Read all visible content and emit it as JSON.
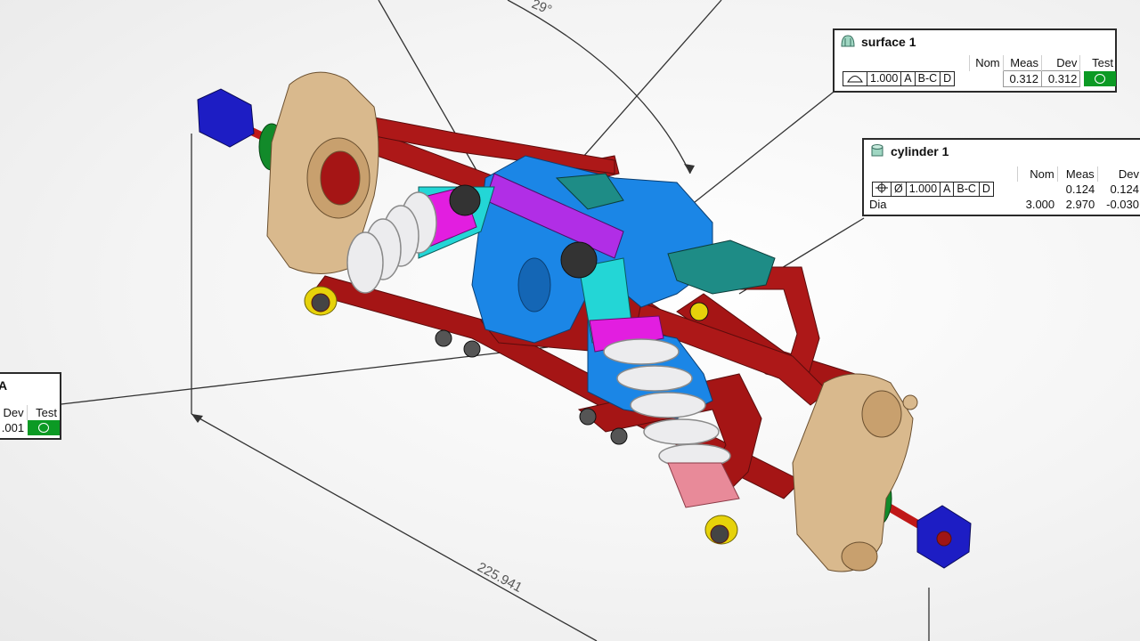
{
  "dimensions": {
    "linear_value": "225.941",
    "angle_value": "29°"
  },
  "callouts": {
    "surface": {
      "title": "surface 1",
      "headers": [
        "Nom",
        "Meas",
        "Dev",
        "Test"
      ],
      "fcf": [
        "1.000",
        "A",
        "B-C",
        "D"
      ],
      "meas": "0.312",
      "dev": "0.312",
      "test_status": "pass",
      "icon": "surface-feature-icon",
      "pass_color": "#0c9a24"
    },
    "cylinder": {
      "title": "cylinder 1",
      "headers": [
        "Nom",
        "Meas",
        "Dev"
      ],
      "fcf": [
        "Ø",
        "1.000",
        "A",
        "B-C",
        "D"
      ],
      "meas": "0.124",
      "dev": "0.124",
      "dia_label": "Dia",
      "dia_nom": "3.000",
      "dia_meas": "2.970",
      "dia_dev": "-0.030",
      "icon": "cylinder-feature-icon"
    },
    "left": {
      "title_partial": "A",
      "headers": [
        "Dev",
        "Test"
      ],
      "dev": ".001",
      "test_status": "pass"
    }
  },
  "colors": {
    "arm": "#a51515",
    "knuckle": "#d9b98d",
    "hub": "#1d1dc4",
    "bracket": "#1b86e6",
    "strut": "#23d6d6",
    "spring": "#d8d8dc",
    "purple": "#b12ee6",
    "magenta": "#e21ee0",
    "teal": "#1e8c86",
    "green": "#128a2a"
  }
}
